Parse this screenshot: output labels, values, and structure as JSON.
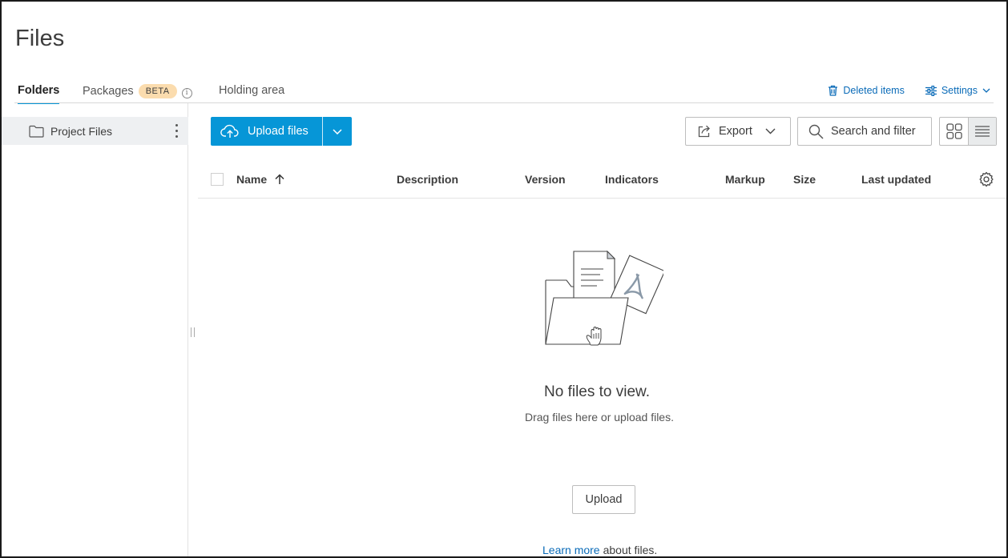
{
  "page": {
    "title": "Files"
  },
  "tabs": [
    {
      "label": "Folders",
      "active": true
    },
    {
      "label": "Packages",
      "badge": "BETA"
    },
    {
      "label": "Holding area"
    }
  ],
  "header_links": {
    "deleted_items": "Deleted items",
    "settings": "Settings"
  },
  "sidebar": {
    "folders": [
      {
        "label": "Project Files"
      }
    ]
  },
  "toolbar": {
    "upload_label": "Upload files",
    "export_label": "Export",
    "search_label": "Search and filter"
  },
  "table": {
    "columns": [
      "Name",
      "Description",
      "Version",
      "Indicators",
      "Markup",
      "Size",
      "Last updated"
    ],
    "sort": {
      "column": "Name",
      "direction": "ascending"
    }
  },
  "empty_state": {
    "title": "No files to view.",
    "subtitle": "Drag files here or upload files.",
    "upload_label": "Upload",
    "learn_more_link": "Learn more",
    "learn_more_rest": "about files."
  },
  "colors": {
    "accent": "#0696d7",
    "link": "#0a6bb8",
    "beta_badge": "#fbdcae"
  }
}
